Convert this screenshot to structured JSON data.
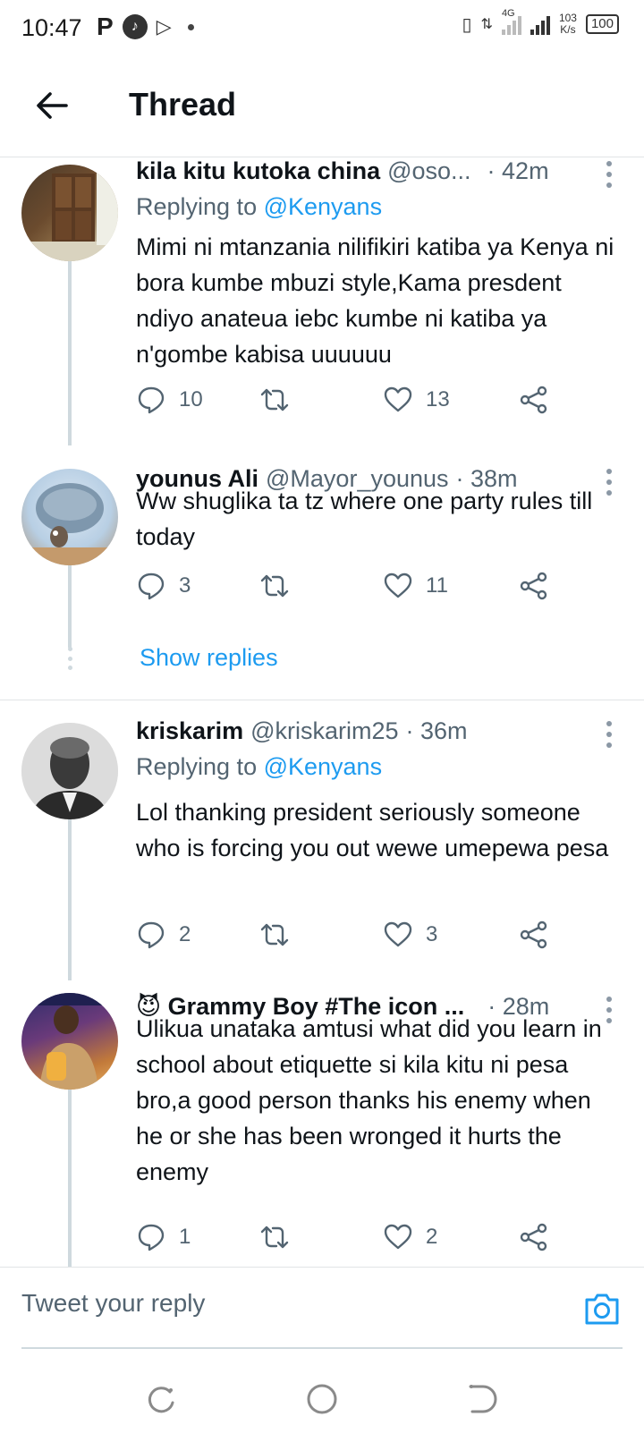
{
  "status_bar": {
    "time": "10:47",
    "icon_p": "P",
    "network": "4G",
    "speed_value": "103",
    "speed_unit": "K/s",
    "battery": "100"
  },
  "header": {
    "title": "Thread"
  },
  "tweets": [
    {
      "name": "kila kitu kutoka china",
      "handle": "@oso...",
      "time": "· 42m",
      "replying_prefix": "Replying to ",
      "replying_to": "@Kenyans",
      "text": "Mimi ni mtanzania nilifikiri katiba ya Kenya ni bora kumbe mbuzi style,Kama presdent ndiyo anateua iebc kumbe ni katiba ya n'gombe kabisa uuuuuu",
      "replies": "10",
      "likes": "13"
    },
    {
      "name": "younus Ali",
      "handle": "@Mayor_younus",
      "time": "· 38m",
      "text": "Ww shuglika ta tz where one party rules till today",
      "replies": "3",
      "likes": "11"
    },
    {
      "name": "kriskarim",
      "handle": "@kriskarim25",
      "time": "· 36m",
      "replying_prefix": "Replying to ",
      "replying_to": "@Kenyans",
      "text": "Lol thanking president seriously someone who is forcing you out wewe umepewa pesa",
      "replies": "2",
      "likes": "3"
    },
    {
      "name": "😈 Grammy Boy #The icon ...",
      "handle": "",
      "time": "· 28m",
      "text": "Ulikua unataka amtusi what did you learn in school about etiquette si kila kitu ni pesa bro,a good person thanks his enemy when he or she has been wronged it hurts the enemy",
      "replies": "1",
      "likes": "2"
    }
  ],
  "show_replies": "Show replies",
  "reply_bar": {
    "placeholder": "Tweet your reply"
  },
  "colors": {
    "accent": "#1d9bf0",
    "text": "#0f1419",
    "secondary": "#536471"
  }
}
